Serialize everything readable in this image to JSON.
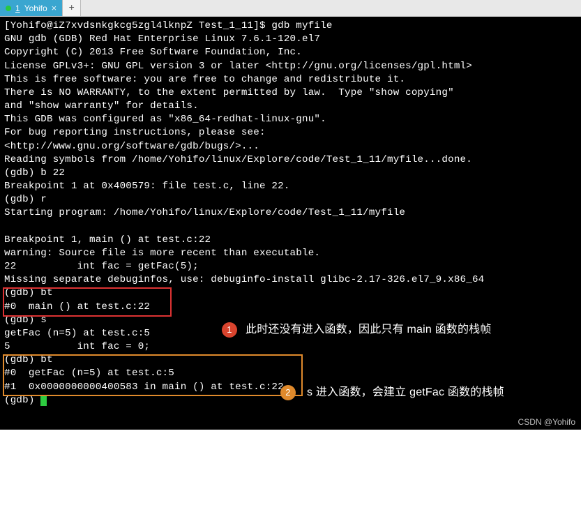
{
  "tabbar": {
    "active_tab": {
      "prefix": "1",
      "title": "Yohifo"
    },
    "newtab_icon": "+"
  },
  "terminal": {
    "lines": [
      "[Yohifo@iZ7xvdsnkgkcg5zgl4lknpZ Test_1_11]$ gdb myfile",
      "GNU gdb (GDB) Red Hat Enterprise Linux 7.6.1-120.el7",
      "Copyright (C) 2013 Free Software Foundation, Inc.",
      "License GPLv3+: GNU GPL version 3 or later <http://gnu.org/licenses/gpl.html>",
      "This is free software: you are free to change and redistribute it.",
      "There is NO WARRANTY, to the extent permitted by law.  Type \"show copying\"",
      "and \"show warranty\" for details.",
      "This GDB was configured as \"x86_64-redhat-linux-gnu\".",
      "For bug reporting instructions, please see:",
      "<http://www.gnu.org/software/gdb/bugs/>...",
      "Reading symbols from /home/Yohifo/linux/Explore/code/Test_1_11/myfile...done.",
      "(gdb) b 22",
      "Breakpoint 1 at 0x400579: file test.c, line 22.",
      "(gdb) r",
      "Starting program: /home/Yohifo/linux/Explore/code/Test_1_11/myfile",
      "",
      "Breakpoint 1, main () at test.c:22",
      "warning: Source file is more recent than executable.",
      "22          int fac = getFac(5);",
      "Missing separate debuginfos, use: debuginfo-install glibc-2.17-326.el7_9.x86_64",
      "(gdb) bt",
      "#0  main () at test.c:22",
      "(gdb) s",
      "getFac (n=5) at test.c:5",
      "5           int fac = 0;",
      "(gdb) bt",
      "#0  getFac (n=5) at test.c:5",
      "#1  0x0000000000400583 in main () at test.c:22",
      "(gdb) "
    ]
  },
  "annotations": [
    {
      "num": "1",
      "text": "此时还没有进入函数，因此只有 main 函数的栈帧"
    },
    {
      "num": "2",
      "text": "s 进入函数，会建立 getFac 函数的栈帧"
    }
  ],
  "watermark": "CSDN @Yohifo"
}
